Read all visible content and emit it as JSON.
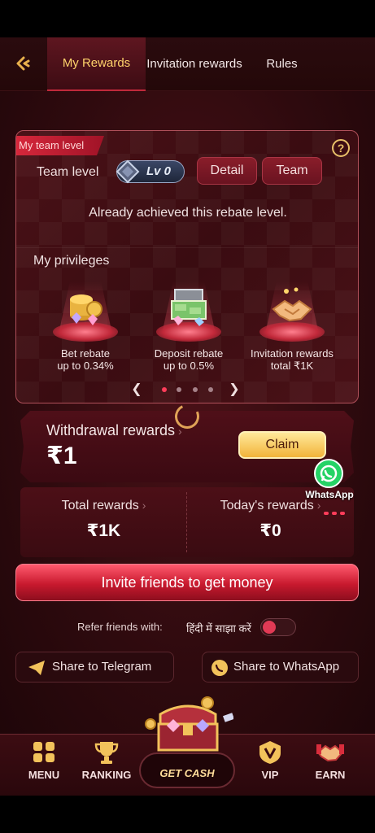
{
  "tabs": {
    "back_icon": "back-arrow-icon",
    "items": [
      {
        "label": "My Rewards",
        "active": true
      },
      {
        "label": "Invitation rewards",
        "active": false
      },
      {
        "label": "Rules",
        "active": false
      }
    ]
  },
  "team_card": {
    "tag": "My team level",
    "team_level_label": "Team level",
    "level_badge": "Lv 0",
    "detail_button": "Detail",
    "team_button": "Team",
    "rebate_message": "Already achieved this rebate level.",
    "privileges_title": "My privileges",
    "privileges": [
      {
        "line1": "Bet rebate",
        "line2": "up to 0.34%",
        "icon": "coins-gems-icon"
      },
      {
        "line1": "Deposit rebate",
        "line2": "up to 0.5%",
        "icon": "money-chest-icon"
      },
      {
        "line1": "Invitation rewards",
        "line2": "total ₹1K",
        "icon": "handshake-icon"
      }
    ],
    "carousel": {
      "total_dots": 4,
      "active_index": 0
    }
  },
  "withdrawal": {
    "title": "Withdrawal rewards",
    "amount": "₹1",
    "claim_button": "Claim"
  },
  "summary": {
    "total_label": "Total rewards",
    "total_value": "₹1K",
    "today_label": "Today's rewards",
    "today_value": "₹0"
  },
  "whatsapp_float": {
    "label": "WhatsApp"
  },
  "invite_button": "Invite friends to get money",
  "refer": {
    "label": "Refer friends with:",
    "language": "हिंदी में साझा करें",
    "toggle_on": false
  },
  "share": {
    "telegram": "Share to Telegram",
    "whatsapp": "Share to WhatsApp"
  },
  "bottom_nav": {
    "menu": "MENU",
    "ranking": "RANKING",
    "get_cash": "GET CASH",
    "vip": "VIP",
    "earn": "EARN"
  },
  "colors": {
    "accent_gold": "#ffd36b",
    "primary_red": "#c8192e",
    "background": "#2e0a0e"
  }
}
